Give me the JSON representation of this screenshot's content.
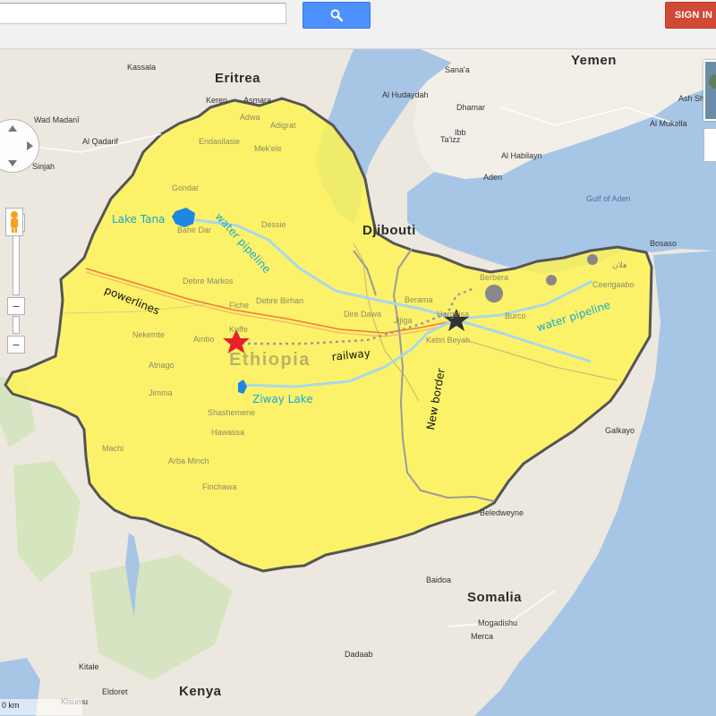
{
  "toolbar": {
    "search_placeholder": "",
    "search_icon": "magnifier-icon",
    "signin_label": "SIGN IN",
    "accent_blue": "#4d90fe",
    "accent_red": "#d14836"
  },
  "countries": {
    "eritrea": "Eritrea",
    "yemen": "Yemen",
    "djibouti": "Djibouti",
    "ethiopia": "Ethiopia",
    "somalia": "Somalia",
    "kenya": "Kenya"
  },
  "water": {
    "gulf_of_aden": "Gulf of Aden"
  },
  "cities": {
    "kassala": "Kassala",
    "asmara": "Asmara",
    "keren": "Keren",
    "wad_madani": "Wad Madanī",
    "al_qadarif": "Al Qadarif",
    "sinjah": "Sinjah",
    "sanaa": "Sana'a",
    "al_hudaydah": "Al Hudaydah",
    "dhamar": "Dhamar",
    "ibb": "Ibb",
    "taizz": "Ta'izz",
    "al_habilayn": "Al Habilayn",
    "aden": "Aden",
    "al_mukalla": "Al Mukalla",
    "ash_shihr": "Ash Shihr",
    "bosaso": "Bosaso",
    "galkayo": "Galkayo",
    "beledweyne": "Beledweyne",
    "baidoa": "Baidoa",
    "mogadishu": "Mogadishu",
    "merca": "Merca",
    "dadaab": "Dadaab",
    "kitale": "Kitale",
    "eldoret": "Eldoret",
    "kisumu": "Kisumu",
    "adwa": "Adwa",
    "adigrat": "Adigrat",
    "endasilasie": "Endasilasie",
    "mekele": "Mek'ele",
    "gondar": "Gondar",
    "bahir_dar": "Bahir Dar",
    "dessie": "Dessie",
    "debre_markos": "Debre Markos",
    "fiche": "Fiche",
    "debre_birhan": "Debre Birhan",
    "nekemte": "Nekemte",
    "ambo": "Ambo",
    "koffe": "Koffe",
    "atnago": "Atnago",
    "jimma": "Jimma",
    "shashemene": "Shashemene",
    "hawassa": "Hawassa",
    "arba_minch": "Arba Minch",
    "machi": "Machi",
    "finchawa": "Finchawa",
    "dire_dawa": "Dire Dawa",
    "berama": "Berama",
    "jijiga": "Jijiga",
    "hargeisa": "Hargeisa",
    "kebri_beyah": "Kebri Beyah",
    "berbera": "Berbera",
    "ceerigaabo": "Ceerigaabo",
    "burco": "Burco",
    "las_anod_arabic": "هلان"
  },
  "annotations": {
    "lake_tana": "Lake Tana",
    "water_pipeline_1": "water pipeline",
    "water_pipeline_2": "water pipeline",
    "powerlines": "powerlines",
    "railway": "railway",
    "ziway_lake": "Ziway Lake",
    "new_border": "New border"
  },
  "map_controls": {
    "zoom_in": "+",
    "zoom_out": "−",
    "scale": "0 km"
  },
  "colors": {
    "highlight_region": "#fff44f",
    "pipeline": "#a9d8ea",
    "powerline": "#f47a3a",
    "sea": "#a7c6e6",
    "red_star": "#e8202a",
    "black_star": "#333333"
  }
}
